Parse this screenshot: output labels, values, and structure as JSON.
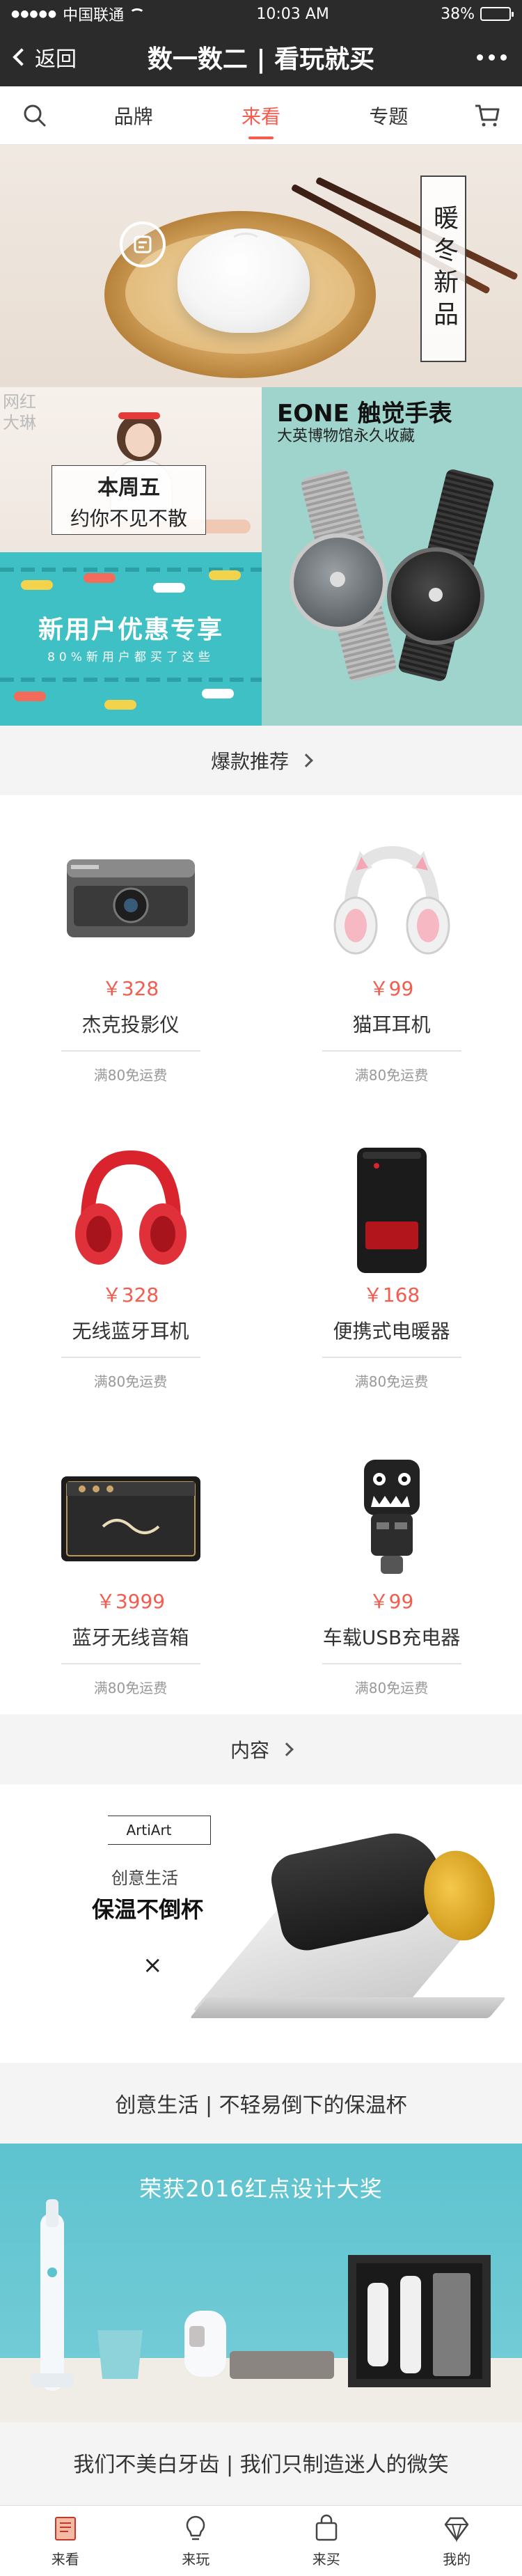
{
  "status_bar": {
    "carrier": "中国联通",
    "time": "10:03 AM",
    "battery": "38%",
    "battery_level": 0.38
  },
  "nav": {
    "back_label": "返回",
    "title": "数一数二 | 看玩就买"
  },
  "tabs": {
    "items": [
      {
        "label": "品牌",
        "active": false
      },
      {
        "label": "来看",
        "active": true
      },
      {
        "label": "专题",
        "active": false
      }
    ],
    "accent": "#f55b4e"
  },
  "hero": {
    "tag": "暖冬新品"
  },
  "promos": {
    "wanghong": "网红大琳",
    "friday_line1": "本周五",
    "friday_line2": "约你不见不散",
    "newuser_title": "新用户优惠专享",
    "newuser_sub": "80%新用户都买了这些",
    "eone_title": "EONE 触觉手表",
    "eone_sub": "大英博物馆永久收藏"
  },
  "section_hot": {
    "label": "爆款推荐"
  },
  "products": [
    {
      "name": "杰克投影仪",
      "price": "￥328",
      "shipping": "满80免运费",
      "icon": "projector"
    },
    {
      "name": "猫耳耳机",
      "price": "￥99",
      "shipping": "满80免运费",
      "icon": "cat-headphones"
    },
    {
      "name": "无线蓝牙耳机",
      "price": "￥328",
      "shipping": "满80免运费",
      "icon": "red-headphones"
    },
    {
      "name": "便携式电暖器",
      "price": "￥168",
      "shipping": "满80免运费",
      "icon": "heater"
    },
    {
      "name": "蓝牙无线音箱",
      "price": "￥3999",
      "shipping": "满80免运费",
      "icon": "marshall-speaker"
    },
    {
      "name": "车载USB充电器",
      "price": "￥99",
      "shipping": "满80免运费",
      "icon": "usb-charger"
    }
  ],
  "section_content": {
    "label": "内容"
  },
  "content_cards": [
    {
      "brand": "ArtiArt",
      "eyebrow": "创意生活",
      "headline": "保温不倒杯",
      "mark": "×",
      "caption": "创意生活 | 不轻易倒下的保温杯"
    },
    {
      "title": "荣获2016红点设计大奖",
      "caption": "我们不美白牙齿 | 我们只制造迷人的微笑"
    }
  ],
  "bottom_tabs": [
    {
      "label": "来看",
      "icon": "book-icon"
    },
    {
      "label": "来玩",
      "icon": "bulb-icon"
    },
    {
      "label": "来买",
      "icon": "bag-icon"
    },
    {
      "label": "我的",
      "icon": "diamond-icon"
    }
  ]
}
